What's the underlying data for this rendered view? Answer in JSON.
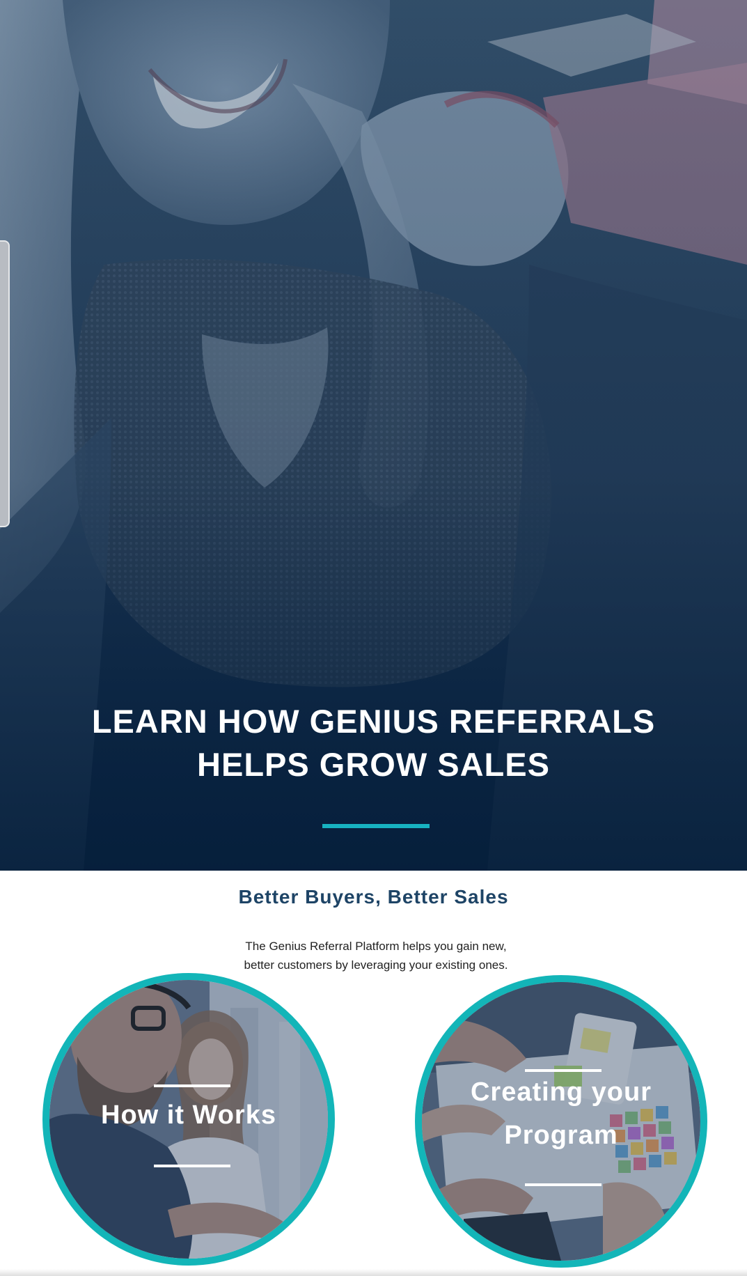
{
  "hero": {
    "title_line1": "LEARN HOW GENIUS REFERRALS",
    "title_line2": "HELPS GROW SALES",
    "accent_color": "#17b2c0"
  },
  "intro": {
    "heading": "Better Buyers, Better Sales",
    "description": "The Genius Referral Platform helps you gain new, better customers by leveraging your existing ones."
  },
  "cards": [
    {
      "label": "How it Works"
    },
    {
      "label_line1": "Creating your",
      "label_line2": "Program"
    }
  ],
  "colors": {
    "brand_teal": "#13b5b8",
    "heading_navy": "#1e4466",
    "hero_navy": "#0b2646"
  }
}
